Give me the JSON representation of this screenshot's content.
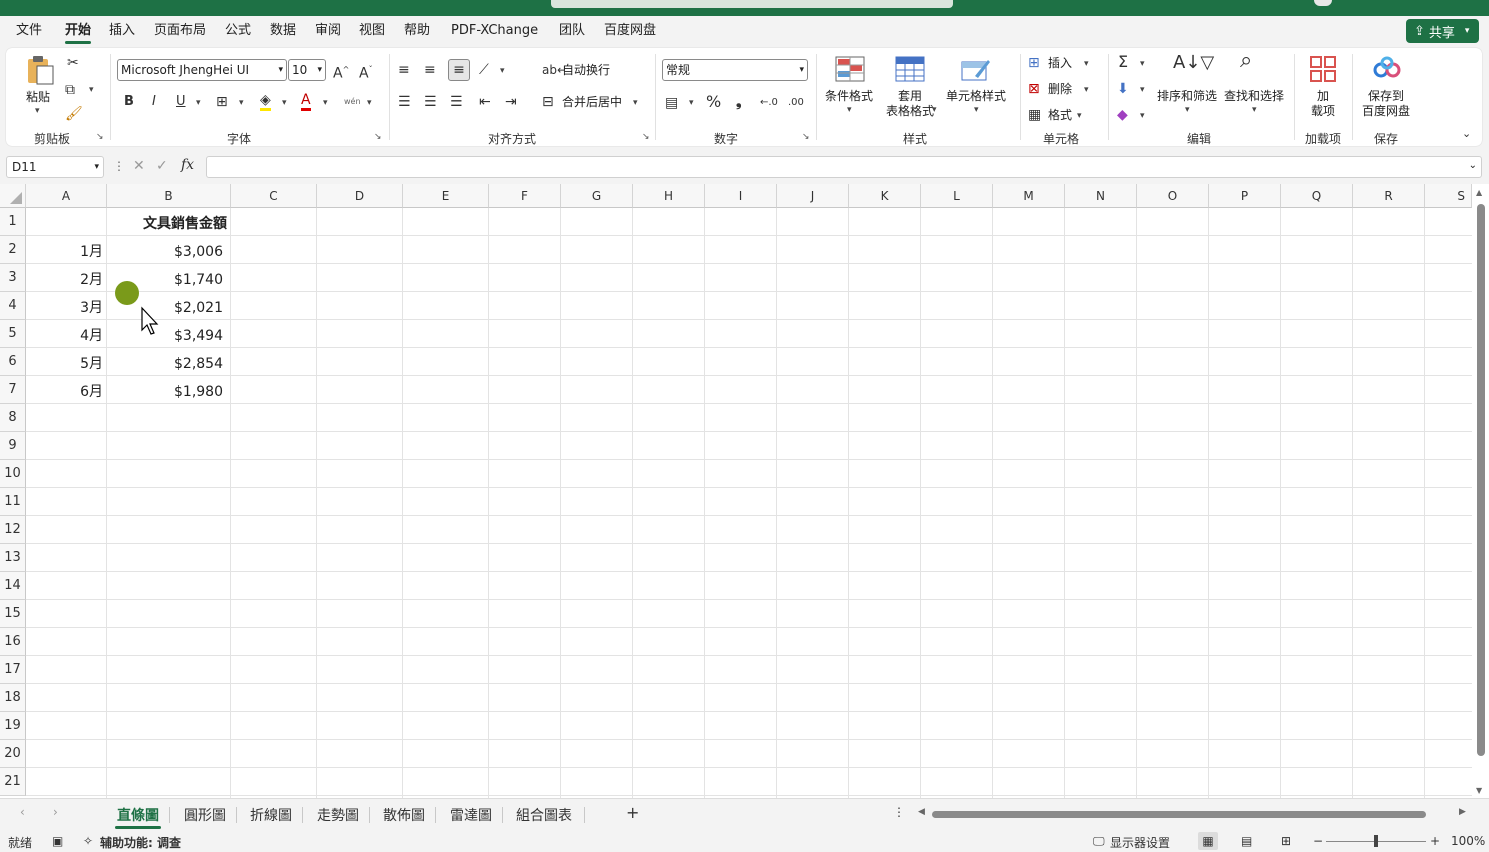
{
  "menu": {
    "items": [
      "文件",
      "开始",
      "插入",
      "页面布局",
      "公式",
      "数据",
      "审阅",
      "视图",
      "帮助",
      "PDF-XChange",
      "团队",
      "百度网盘"
    ],
    "active": "开始",
    "share": "共享"
  },
  "ribbon": {
    "clipboard": {
      "paste": "粘贴",
      "group": "剪贴板"
    },
    "font": {
      "name": "Microsoft JhengHei UI",
      "size": "10",
      "group": "字体",
      "bold": "B",
      "italic": "I",
      "underline": "U",
      "phonetic": "wén"
    },
    "alignment": {
      "wrap": "自动换行",
      "merge": "合并后居中",
      "group": "对齐方式"
    },
    "number": {
      "format": "常规",
      "group": "数字"
    },
    "styles": {
      "conditional": "条件格式",
      "table_line1": "套用",
      "table_line2": "表格格式",
      "cell_styles": "单元格样式",
      "group": "样式"
    },
    "cells": {
      "insert": "插入",
      "delete": "删除",
      "format": "格式",
      "group": "单元格"
    },
    "editing": {
      "sort": "排序和筛选",
      "find": "查找和选择",
      "group": "编辑"
    },
    "addins": {
      "line1": "加",
      "line2": "载项",
      "group": "加载项"
    },
    "save": {
      "line1": "保存到",
      "line2": "百度网盘",
      "group": "保存"
    }
  },
  "formula_bar": {
    "name_box": "D11",
    "fx": "fx",
    "value": ""
  },
  "columns": [
    "A",
    "B",
    "C",
    "D",
    "E",
    "F",
    "G",
    "H",
    "I",
    "J",
    "K",
    "L",
    "M",
    "N",
    "O",
    "P",
    "Q",
    "R",
    "S"
  ],
  "rows": [
    "1",
    "2",
    "3",
    "4",
    "5",
    "6",
    "7",
    "8",
    "9",
    "10",
    "11",
    "12",
    "13",
    "14",
    "15",
    "16",
    "17",
    "18",
    "19",
    "20",
    "21"
  ],
  "cells": {
    "header": "文具銷售金額",
    "data": [
      {
        "month": "1月",
        "amount": "$3,006"
      },
      {
        "month": "2月",
        "amount": "$1,740"
      },
      {
        "month": "3月",
        "amount": "$2,021"
      },
      {
        "month": "4月",
        "amount": "$3,494"
      },
      {
        "month": "5月",
        "amount": "$2,854"
      },
      {
        "month": "6月",
        "amount": "$1,980"
      }
    ]
  },
  "sheets": {
    "tabs": [
      "直條圖",
      "圓形圖",
      "折線圖",
      "走勢圖",
      "散佈圖",
      "雷達圖",
      "組合圖表"
    ],
    "active": "直條圖",
    "add": "+"
  },
  "status": {
    "ready": "就绪",
    "accessibility": "辅助功能: 调查",
    "display": "显示器设置",
    "zoom": "100%"
  },
  "colors": {
    "accent": "#1e7145",
    "cursor_dot": "#7a9a1a"
  }
}
